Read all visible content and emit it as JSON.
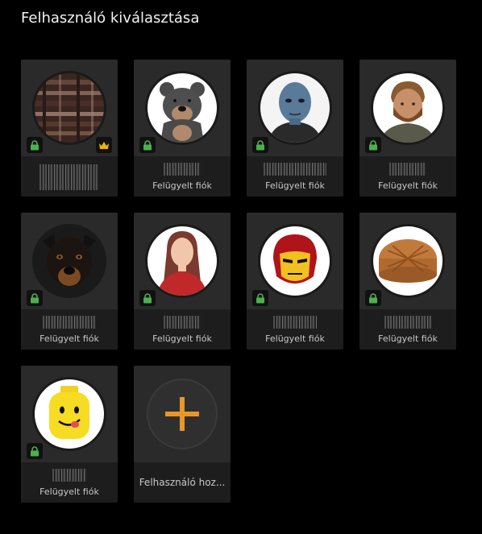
{
  "page": {
    "title": "Felhasználó kiválasztása"
  },
  "users": [
    {
      "id": "u1",
      "avatar": "abstract-texture-avatar",
      "status": "",
      "locked": true,
      "owner": true
    },
    {
      "id": "u2",
      "avatar": "bear-avatar",
      "status": "Felügyelt fiók",
      "locked": true,
      "owner": false
    },
    {
      "id": "u3",
      "avatar": "alien-avatar",
      "status": "Felügyelt fiók",
      "locked": true,
      "owner": false
    },
    {
      "id": "u4",
      "avatar": "man-portrait-avatar",
      "status": "Felügyelt fiók",
      "locked": true,
      "owner": false
    },
    {
      "id": "u5",
      "avatar": "dog-avatar",
      "status": "Felügyelt fiók",
      "locked": true,
      "owner": false
    },
    {
      "id": "u6",
      "avatar": "woman-silhouette-avatar",
      "status": "Felügyelt fiók",
      "locked": true,
      "owner": false
    },
    {
      "id": "u7",
      "avatar": "iron-mask-avatar",
      "status": "Felügyelt fiók",
      "locked": true,
      "owner": false
    },
    {
      "id": "u8",
      "avatar": "mooncake-avatar",
      "status": "Felügyelt fiók",
      "locked": true,
      "owner": false
    },
    {
      "id": "u9",
      "avatar": "toy-head-avatar",
      "status": "Felügyelt fiók",
      "locked": true,
      "owner": false
    }
  ],
  "add_user": {
    "label": "Felhasználó hoz...",
    "icon": "plus-icon"
  },
  "colors": {
    "lock": "#4caf50",
    "crown": "#f0b400",
    "plus": "#e8962a"
  }
}
